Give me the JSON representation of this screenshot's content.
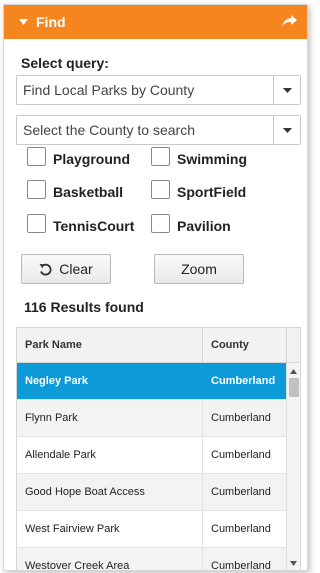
{
  "header": {
    "title": "Find",
    "collapse_icon": "triangle-down-icon",
    "popout_icon": "share-arrow-icon"
  },
  "query": {
    "label": "Select query:",
    "selected": "Find Local Parks by County"
  },
  "county": {
    "placeholder": "Select the County to search"
  },
  "filters": [
    {
      "label": "Playground",
      "checked": false
    },
    {
      "label": "Swimming",
      "checked": false
    },
    {
      "label": "Basketball",
      "checked": false
    },
    {
      "label": "SportField",
      "checked": false
    },
    {
      "label": "TennisCourt",
      "checked": false
    },
    {
      "label": "Pavilion",
      "checked": false
    }
  ],
  "buttons": {
    "clear": "Clear",
    "zoom": "Zoom"
  },
  "results": {
    "count_text": "116 Results found"
  },
  "grid": {
    "columns": [
      "Park Name",
      "County"
    ],
    "rows": [
      {
        "name": "Negley Park",
        "county": "Cumberland",
        "selected": true
      },
      {
        "name": "Flynn Park",
        "county": "Cumberland",
        "selected": false
      },
      {
        "name": "Allendale Park",
        "county": "Cumberland",
        "selected": false
      },
      {
        "name": "Good Hope Boat Access",
        "county": "Cumberland",
        "selected": false
      },
      {
        "name": "West Fairview Park",
        "county": "Cumberland",
        "selected": false
      },
      {
        "name": "Westover Creek Area",
        "county": "Cumberland",
        "selected": false
      }
    ]
  },
  "colors": {
    "header": "#f5861f",
    "selected_row": "#0c9ad8"
  }
}
